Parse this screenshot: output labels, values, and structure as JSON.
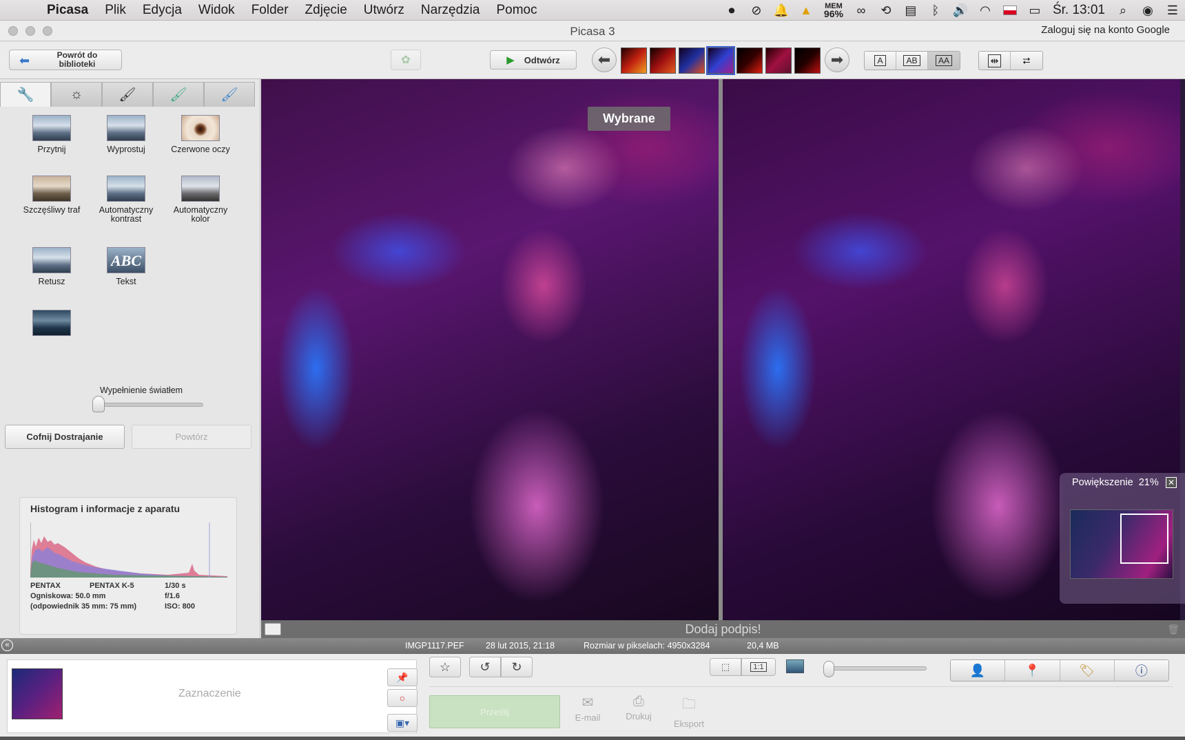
{
  "menubar": {
    "app": "Picasa",
    "items": [
      "Plik",
      "Edycja",
      "Widok",
      "Folder",
      "Zdjęcie",
      "Utwórz",
      "Narzędzia",
      "Pomoc"
    ],
    "mem_label": "MEM",
    "mem_value": "96%",
    "clock": "Śr. 13:01"
  },
  "window": {
    "title": "Picasa 3",
    "login": "Zaloguj się na konto Google"
  },
  "toolbar": {
    "back_label": "Powrót do biblioteki",
    "play_label": "Odtwórz",
    "view_a": "A",
    "view_ab": "AB",
    "view_aa": "AA"
  },
  "tools": {
    "crop": "Przytnij",
    "straighten": "Wyprostuj",
    "redeye": "Czerwone oczy",
    "lucky": "Szczęśliwy traf",
    "auto_contrast": "Automatyczny kontrast",
    "auto_color": "Automatyczny kolor",
    "retouch": "Retusz",
    "text": "Tekst",
    "fill_light": "Wypełnienie światłem",
    "fill_light_value": 0.0,
    "undo": "Cofnij Dostrajanie",
    "redo": "Powtórz"
  },
  "histogram": {
    "title": "Histogram i informacje z aparatu",
    "make": "PENTAX",
    "model": "PENTAX K-5",
    "exposure": "1/30 s",
    "focal": "Ogniskowa: 50.0 mm",
    "aperture": "f/1.6",
    "equiv": "(odpowiednik 35 mm:  75 mm)",
    "iso": "ISO: 800"
  },
  "viewer": {
    "selected_tag": "Wybrane",
    "zoom_label": "Powiększenie",
    "zoom_value": "21%",
    "caption_placeholder": "Dodaj podpis!"
  },
  "info": {
    "filename": "IMGP1117.PEF",
    "date": "28 lut 2015, 21:18",
    "pixels": "Rozmiar w pikselach: 4950x3284",
    "filesize": "20,4 MB"
  },
  "bottom": {
    "tray_label": "Zaznaczenie",
    "share": "Prześlij",
    "email": "E-mail",
    "print": "Drukuj",
    "export": "Eksport",
    "ratio": "1:1"
  },
  "colors": {
    "accent": "#3a5fd0",
    "play_green": "#2a9a2a"
  }
}
